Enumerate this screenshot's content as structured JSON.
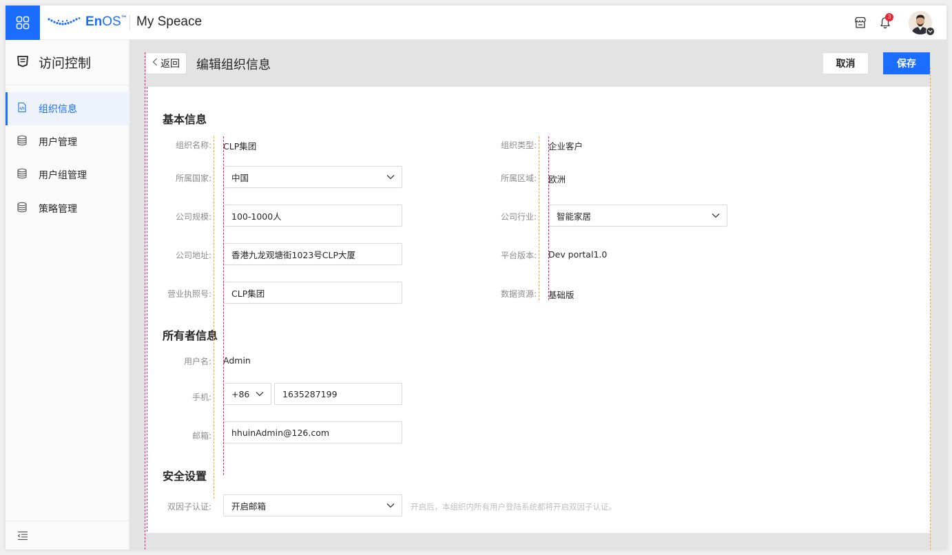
{
  "header": {
    "app_grid_icon": "app-grid-icon",
    "logo_prefix": "En",
    "logo_suffix": "OS",
    "logo_tm": "™",
    "space_title": "My Speace",
    "notification_count": "3",
    "accent_color": "#1a6dff"
  },
  "sidebar": {
    "title": "访问控制",
    "items": [
      {
        "label": "组织信息",
        "icon": "code-file-icon",
        "active": true
      },
      {
        "label": "用户管理",
        "icon": "database-icon",
        "active": false
      },
      {
        "label": "用户组管理",
        "icon": "database-icon",
        "active": false
      },
      {
        "label": "策略管理",
        "icon": "database-icon",
        "active": false
      }
    ],
    "collapse_icon": "collapse-menu-icon"
  },
  "page": {
    "back_label": "返回",
    "title": "编辑组织信息",
    "cancel_label": "取消",
    "save_label": "保存"
  },
  "basic_info": {
    "section_title": "基本信息",
    "org_name_label": "组织名称:",
    "org_name_value": "CLP集团",
    "org_type_label": "组织类型:",
    "org_type_value": "企业客户",
    "country_label": "所属国家:",
    "country_value": "中国",
    "region_label": "所属区域:",
    "region_value": "欧洲",
    "scale_label": "公司规模:",
    "scale_value": "100-1000人",
    "industry_label": "公司行业:",
    "industry_value": "智能家居",
    "address_label": "公司地址:",
    "address_value": "香港九龙观塘街1023号CLP大厦",
    "platform_label": "平台版本:",
    "platform_value": "Dev portal1.0",
    "license_label": "营业执照号:",
    "license_value": "CLP集团",
    "resource_label": "数据资源:",
    "resource_value": "基础版"
  },
  "owner_info": {
    "section_title": "所有者信息",
    "username_label": "用户名:",
    "username_value": "Admin",
    "phone_label": "手机:",
    "phone_code": "+86",
    "phone_value": "1635287199",
    "email_label": "邮箱:",
    "email_value": "hhuinAdmin@126.com"
  },
  "security": {
    "section_title": "安全设置",
    "two_factor_label": "双因子认证:",
    "two_factor_value": "开启邮箱",
    "two_factor_hint": "开启后，本组织内所有用户登陆系统都将开启双因子认证。"
  }
}
